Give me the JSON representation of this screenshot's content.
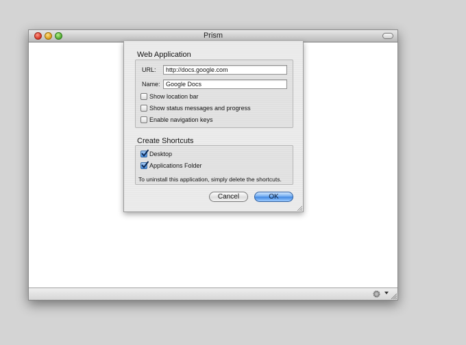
{
  "window": {
    "title": "Prism"
  },
  "sheet": {
    "web_application": {
      "title": "Web Application",
      "url_label": "URL:",
      "url_value": "http://docs.google.com",
      "name_label": "Name:",
      "name_value": "Google Docs",
      "options": [
        {
          "label": "Show location bar",
          "checked": false
        },
        {
          "label": "Show status messages and progress",
          "checked": false
        },
        {
          "label": "Enable navigation keys",
          "checked": false
        }
      ]
    },
    "create_shortcuts": {
      "title": "Create Shortcuts",
      "options": [
        {
          "label": "Desktop",
          "checked": true
        },
        {
          "label": "Applications Folder",
          "checked": true
        }
      ],
      "note": "To uninstall this application, simply delete the shortcuts."
    },
    "buttons": {
      "cancel": "Cancel",
      "ok": "OK"
    }
  },
  "icons": {
    "close": "close-icon",
    "minimize": "minimize-icon",
    "zoom": "zoom-icon",
    "toolbar_toggle": "toolbar-toggle-icon",
    "action": "gear-icon",
    "menu_arrow": "chevron-down-icon",
    "resize": "resize-grip-icon"
  },
  "colors": {
    "desktop": "#d4d4d4",
    "ok_button": "#4b8fe0",
    "check_accent": "#4b8fe0"
  }
}
